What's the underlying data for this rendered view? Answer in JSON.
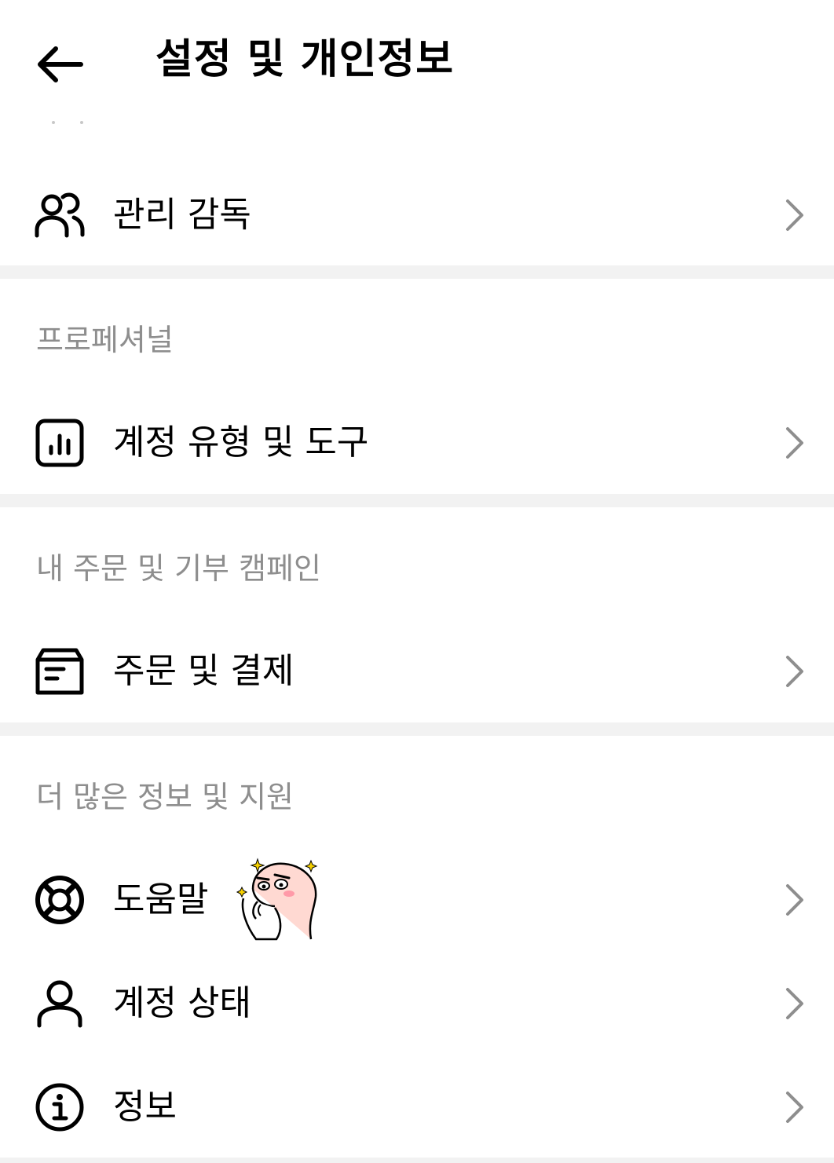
{
  "header": {
    "title": "설정 및 개인정보"
  },
  "items": {
    "supervision": {
      "label": "관리 감독",
      "icon": "people-icon"
    },
    "account_tools": {
      "label": "계정 유형 및 도구",
      "icon": "chart-icon"
    },
    "orders": {
      "label": "주문 및 결제",
      "icon": "box-icon"
    },
    "help": {
      "label": "도움말",
      "icon": "lifebuoy-icon"
    },
    "account_status": {
      "label": "계정 상태",
      "icon": "person-icon"
    },
    "about": {
      "label": "정보",
      "icon": "info-icon"
    }
  },
  "sections": {
    "professional": "프로페셔널",
    "orders_campaigns": "내 주문 및 기부 캠페인",
    "more_info": "더 많은 정보 및 지원"
  },
  "colors": {
    "text": "#000000",
    "section_label": "#8e8e8e",
    "divider": "#f2f2f2",
    "chevron": "#8e8e8e"
  }
}
